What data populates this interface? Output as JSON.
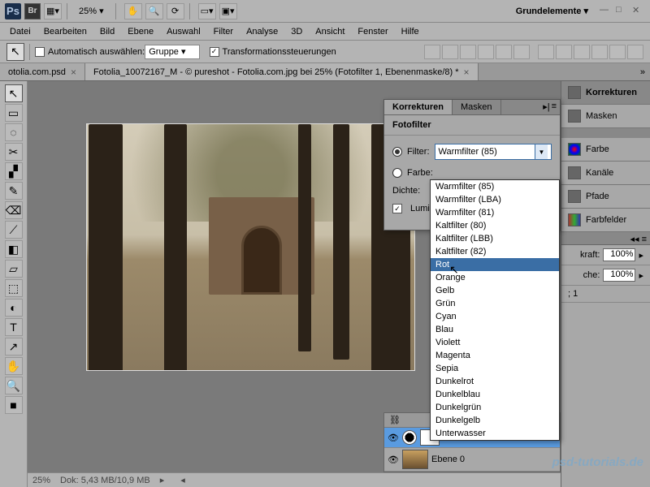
{
  "app": {
    "ps_icon": "Ps",
    "br_icon": "Br"
  },
  "zoom": "25%",
  "preset": "Grundelemente",
  "menu": [
    "Datei",
    "Bearbeiten",
    "Bild",
    "Ebene",
    "Auswahl",
    "Filter",
    "Analyse",
    "3D",
    "Ansicht",
    "Fenster",
    "Hilfe"
  ],
  "options": {
    "auto_label": "Automatisch auswählen:",
    "group": "Gruppe",
    "transform_label": "Transformationssteuerungen"
  },
  "tabs": [
    {
      "label": "otolia.com.psd",
      "active": false
    },
    {
      "label": "Fotolia_10072167_M - © pureshot - Fotolia.com.jpg bei 25% (Fotofilter 1, Ebenenmaske/8) *",
      "active": true
    }
  ],
  "status": {
    "zoom": "25%",
    "doc": "Dok: 5,43 MB/10,9 MB"
  },
  "right_panels": {
    "korrekturen": "Korrekturen",
    "masken": "Masken",
    "farbe": "Farbe",
    "kanaele": "Kanäle",
    "pfade": "Pfade",
    "farbfelder": "Farbfelder",
    "kraft_label": "kraft:",
    "kraft_val": "100%",
    "flaeche_label": "che:",
    "flaeche_val": "100%",
    "s1": "; 1"
  },
  "adjust": {
    "tab1": "Korrekturen",
    "tab2": "Masken",
    "title": "Fotofilter",
    "filter_label": "Filter:",
    "filter_value": "Warmfilter (85)",
    "farbe_label": "Farbe:",
    "dichte_label": "Dichte:",
    "luminanz_label": "Luminar"
  },
  "dropdown": {
    "items": [
      "Warmfilter (85)",
      "Warmfilter (LBA)",
      "Warmfilter (81)",
      "Kaltfilter (80)",
      "Kaltfilter (LBB)",
      "Kaltfilter (82)",
      "Rot",
      "Orange",
      "Gelb",
      "Grün",
      "Cyan",
      "Blau",
      "Violett",
      "Magenta",
      "Sepia",
      "Dunkelrot",
      "Dunkelblau",
      "Dunkelgrün",
      "Dunkelgelb",
      "Unterwasser"
    ],
    "highlighted_index": 6
  },
  "layers": {
    "layer0": "Ebene 0"
  },
  "watermark": "psd-tutorials.de",
  "tools": [
    "↖",
    "▭",
    "◌",
    "✂",
    "▞",
    "✎",
    "⌫",
    "⟋",
    "◧",
    "▱",
    "⬚",
    "◐",
    "T",
    "↗",
    "✋",
    "🔍",
    "■"
  ]
}
